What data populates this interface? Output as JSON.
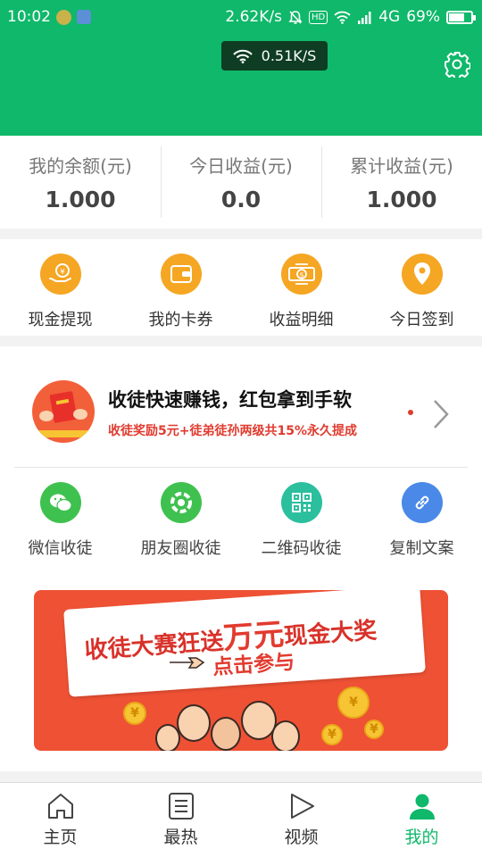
{
  "status_bar": {
    "time": "10:02",
    "network_speed": "2.62K/s",
    "hd_label": "HD",
    "network_type": "4G",
    "battery": "69%",
    "battery_level": 0.69
  },
  "header": {
    "wifi_speed": "0.51K/S",
    "settings_icon": "gear-icon",
    "color": "#0fb86a"
  },
  "stats": [
    {
      "label": "我的余额(元)",
      "value": "1.000"
    },
    {
      "label": "今日收益(元)",
      "value": "0.0"
    },
    {
      "label": "累计收益(元)",
      "value": "1.000"
    }
  ],
  "actions": [
    {
      "label": "现金提现",
      "icon": "cash-withdraw-icon",
      "color": "#f5a623"
    },
    {
      "label": "我的卡券",
      "icon": "wallet-icon",
      "color": "#f5a623"
    },
    {
      "label": "收益明细",
      "icon": "income-detail-icon",
      "color": "#f5a623"
    },
    {
      "label": "今日签到",
      "icon": "location-pin-icon",
      "color": "#f5a623"
    }
  ],
  "promo": {
    "title": "收徒快速赚钱，红包拿到手软",
    "subtitle": "收徒奖励5元+徒弟徒孙两级共15%永久提成"
  },
  "shares": [
    {
      "label": "微信收徒",
      "icon": "wechat-icon",
      "color": "#3fc14f"
    },
    {
      "label": "朋友圈收徒",
      "icon": "moments-icon",
      "color": "#3fc14f"
    },
    {
      "label": "二维码收徒",
      "icon": "qrcode-icon",
      "color": "#2bbf9e"
    },
    {
      "label": "复制文案",
      "icon": "link-icon",
      "color": "#4a89e8"
    }
  ],
  "banner": {
    "line1_prefix": "收徒大赛狂送",
    "line1_emph": "万元",
    "line1_suffix": "现金大奖",
    "line2": "点击参与",
    "coin_symbol": "¥"
  },
  "bottom_nav": [
    {
      "label": "主页",
      "icon": "home-icon",
      "active": false
    },
    {
      "label": "最热",
      "icon": "list-icon",
      "active": false
    },
    {
      "label": "视频",
      "icon": "play-icon",
      "active": false
    },
    {
      "label": "我的",
      "icon": "person-icon",
      "active": true
    }
  ]
}
